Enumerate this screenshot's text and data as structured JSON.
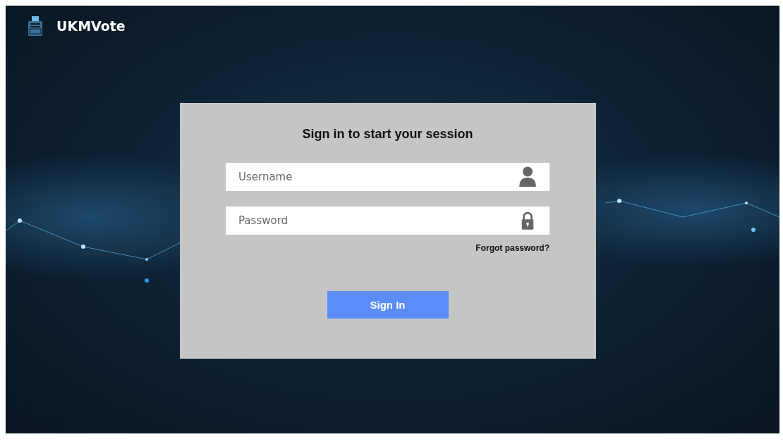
{
  "header": {
    "app_name": "UKMVote"
  },
  "login": {
    "title": "Sign in to start your session",
    "fields": [
      {
        "kind": "username",
        "placeholder": "Username"
      },
      {
        "kind": "password",
        "placeholder": "Password"
      }
    ],
    "forgot_link": "Forgot password?",
    "submit": "Sign In"
  }
}
